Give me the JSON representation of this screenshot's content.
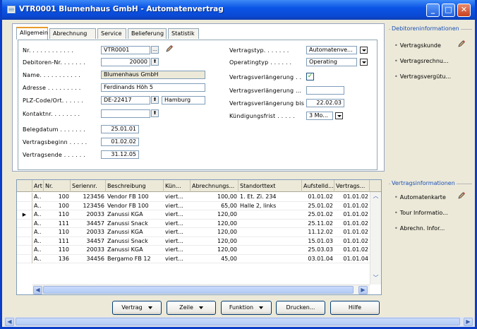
{
  "window": {
    "title": "VTR0001 Blumenhaus GmbH - Automatenvertrag"
  },
  "tabs": [
    "Allgemein",
    "Abrechnung",
    "Service",
    "Belieferung",
    "Statistik"
  ],
  "form": {
    "left": [
      {
        "label": "Nr. . . . . . . . . . . .",
        "value": "VTR0001"
      },
      {
        "label": "Debitoren-Nr. . . . . . .",
        "value": "20000"
      },
      {
        "label": "Name. . . . . . . . . . .",
        "value": "Blumenhaus GmbH"
      },
      {
        "label": "Adresse . . . . . . . . .",
        "value": "Ferdinands Höh 5"
      },
      {
        "label": "PLZ-Code/Ort. . . . . .",
        "value": "DE-22417",
        "value2": "Hamburg"
      },
      {
        "label": "Kontaktnr. . . . . . . .",
        "value": ""
      },
      {
        "label": "Belegdatum . . . . . . .",
        "value": "25.01.01"
      },
      {
        "label": "Vertragsbeginn . . . . .",
        "value": "01.02.02"
      },
      {
        "label": "Vertragsende . . . . . .",
        "value": "31.12.05"
      }
    ],
    "right": [
      {
        "label": "Vertragstyp. . . . . . .",
        "value": "Automatenve..."
      },
      {
        "label": "Operatingtyp . . . . . .",
        "value": "Operating"
      },
      {
        "label": "Vertragsverlängerung . .",
        "value": "✓"
      },
      {
        "label": "Vertragsverlängerung ...",
        "value": ""
      },
      {
        "label": "Vertragsverlängerung bis",
        "value": "22.02.03"
      },
      {
        "label": "Kündigungsfrist . . . . .",
        "value": "3 Mo..."
      }
    ]
  },
  "grid": {
    "headers": [
      "Art",
      "Nr.",
      "Seriennr.",
      "Beschreibung",
      "Kün...",
      "Abrechnungs...",
      "Standorttext",
      "Aufstelld...",
      "Vertrags..."
    ],
    "rows": [
      [
        "A..",
        "100",
        "123456",
        "Vendor FB 100",
        "viert...",
        "100,00",
        "1. Et. Zi. 234",
        "01.01.02",
        "01.01.02"
      ],
      [
        "A..",
        "100",
        "123456",
        "Vendor FB 100",
        "viert...",
        "65,00",
        "Halle 2, links",
        "25.01.02",
        "01.01.02"
      ],
      [
        "A..",
        "110",
        "20033",
        "Zanussi KGA",
        "viert...",
        "120,00",
        "",
        "25.01.02",
        "01.01.02"
      ],
      [
        "A..",
        "111",
        "34457",
        "Zanussi Snack",
        "viert...",
        "120,00",
        "",
        "25.11.02",
        "01.01.02"
      ],
      [
        "A..",
        "110",
        "20033",
        "Zanussi KGA",
        "viert...",
        "120,00",
        "",
        "11.12.02",
        "01.01.02"
      ],
      [
        "A..",
        "111",
        "34457",
        "Zanussi Snack",
        "viert...",
        "120,00",
        "",
        "15.01.03",
        "01.01.02"
      ],
      [
        "A..",
        "110",
        "20033",
        "Zanussi KGA",
        "viert...",
        "120,00",
        "",
        "25.03.03",
        "01.01.02"
      ],
      [
        "A..",
        "136",
        "34456",
        "Bergamo FB 12",
        "viert...",
        "45,00",
        "",
        "03.01.04",
        "01.01.04"
      ]
    ]
  },
  "buttons": [
    "Vertrag",
    "Zeile",
    "Funktion",
    "Drucken...",
    "Hilfe"
  ],
  "side": {
    "group1": {
      "title": "Debitoreninformationen",
      "items": [
        "Vertragskunde",
        "Vertragsrechnu...",
        "Vertragsvergütu..."
      ]
    },
    "group2": {
      "title": "Vertragsinformationen",
      "items": [
        "Automatenkarte",
        "Tour Informatio...",
        "Abrechn. Infor..."
      ]
    }
  }
}
